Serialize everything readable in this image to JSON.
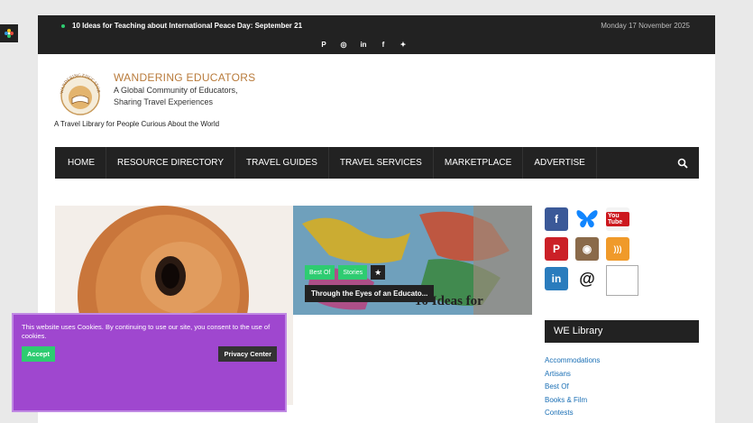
{
  "topbar": {
    "ticker": "10 Ideas for Teaching about International Peace Day: September 21",
    "date": "Monday 17 November 2025",
    "social_icons": [
      "pinterest-icon",
      "instagram-icon",
      "linkedin-icon",
      "facebook-icon",
      "twitter-icon"
    ],
    "social_glyphs": [
      "P",
      "◎",
      "in",
      "f",
      "✦"
    ]
  },
  "brand": {
    "title": "WANDERING EDUCATORS",
    "subtitle_line1": "A Global Community of Educators,",
    "subtitle_line2": "Sharing Travel Experiences",
    "logo_text": "WANDERING EDUCATORS",
    "tagline": "A Travel Library for People Curious About the World"
  },
  "nav": {
    "items": [
      "HOME",
      "RESOURCE DIRECTORY",
      "TRAVEL GUIDES",
      "TRAVEL SERVICES",
      "MARKETPLACE",
      "ADVERTISE"
    ]
  },
  "hero": {
    "tags": [
      "Best Of",
      "Stories"
    ],
    "star": "★",
    "title": "Through the Eyes of an Educato...",
    "image_text": "10 Ideas for"
  },
  "sidebar": {
    "social": [
      {
        "name": "facebook-icon",
        "glyph": "f",
        "color": "#3b5998"
      },
      {
        "name": "bluesky-icon",
        "glyph": "",
        "color": "#1185fe"
      },
      {
        "name": "youtube-icon",
        "glyph": "You Tube",
        "color": "#cc181e"
      },
      {
        "name": "pinterest-icon",
        "glyph": "P",
        "color": "#cb2027"
      },
      {
        "name": "instagram-icon",
        "glyph": "◉",
        "color": "#8a6a4a"
      },
      {
        "name": "rss-icon",
        "glyph": ")))",
        "color": "#f09a2a"
      },
      {
        "name": "linkedin-icon",
        "glyph": "in",
        "color": "#2a7cbd"
      },
      {
        "name": "threads-icon",
        "glyph": "@",
        "color": "#ffffff"
      }
    ],
    "library_heading": "WE Library",
    "library_links": [
      "Accommodations",
      "Artisans",
      "Best Of",
      "Books & Film",
      "Contests"
    ]
  },
  "cookie": {
    "text": "This website uses Cookies. By continuing to use our site, you consent to the use of cookies.",
    "accept": "Accept",
    "privacy": "Privacy Center"
  },
  "colors": {
    "accent_green": "#2ecc71",
    "dark": "#222222",
    "cookie_purple": "#9f47cf",
    "brand_brown": "#b87a3a",
    "link_blue": "#1a6fb5"
  }
}
